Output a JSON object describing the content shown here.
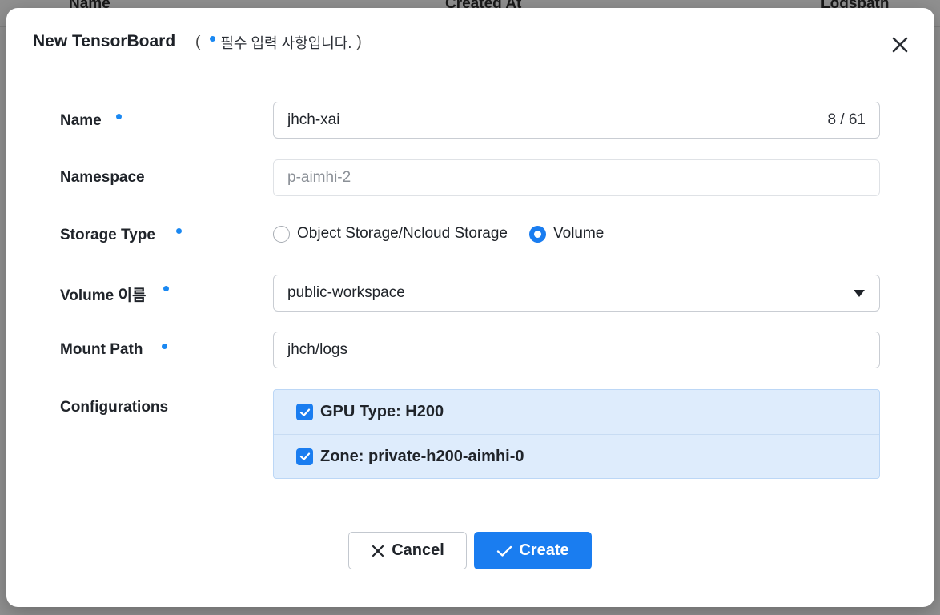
{
  "background": {
    "columns": [
      "Name",
      "Created At",
      "Logspath"
    ]
  },
  "modal": {
    "title": "New TensorBoard",
    "paren_open": "(",
    "paren_close": ")",
    "required_note": "필수 입력 사항입니다."
  },
  "form": {
    "name": {
      "label": "Name",
      "value": "jhch-xai",
      "counter": "8 / 61"
    },
    "namespace": {
      "label": "Namespace",
      "placeholder": "p-aimhi-2"
    },
    "storage_type": {
      "label": "Storage Type",
      "options": [
        "Object Storage/Ncloud Storage",
        "Volume"
      ],
      "selected": "Volume"
    },
    "volume": {
      "label": "Volume 이름",
      "value": "public-workspace"
    },
    "mount_path": {
      "label": "Mount Path",
      "value": "jhch/logs"
    },
    "configurations": {
      "label": "Configurations",
      "items": [
        {
          "label": "GPU Type: H200",
          "checked": true
        },
        {
          "label": "Zone: private-h200-aimhi-0",
          "checked": true
        }
      ]
    }
  },
  "actions": {
    "cancel_label": "Cancel",
    "create_label": "Create"
  },
  "colors": {
    "accent": "#1a7df0",
    "required_dot": "#1a88f2",
    "config_bg": "#deecfc"
  },
  "icons": {
    "close": "close-icon",
    "cancel": "close-icon",
    "create": "check-icon",
    "caret": "caret-down-icon"
  }
}
